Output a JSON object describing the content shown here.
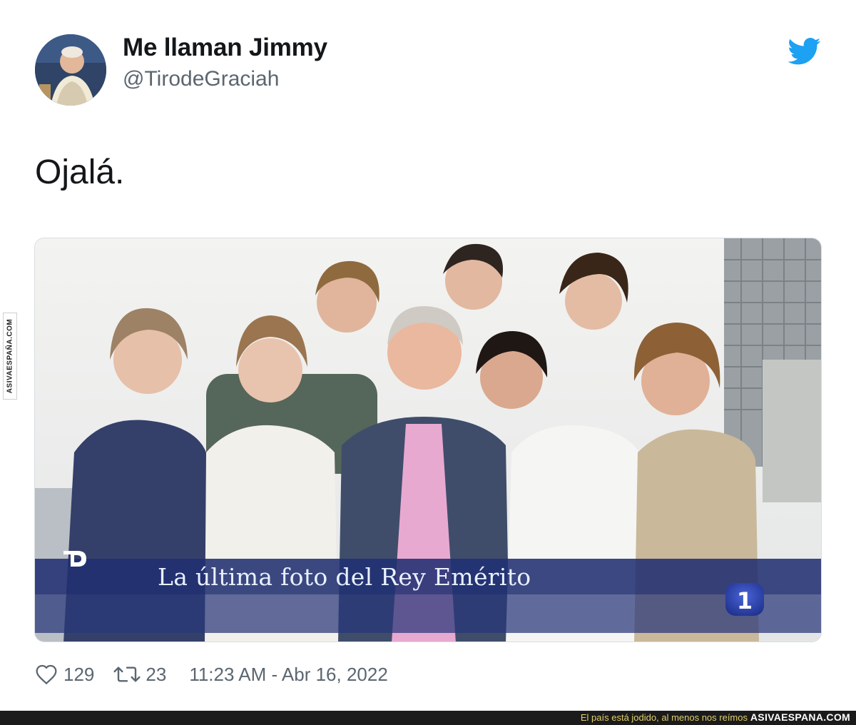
{
  "tweet": {
    "display_name": "Me llaman Jimmy",
    "handle": "@TirodeGraciah",
    "text": "Ojalá.",
    "avatar_icon": "user-avatar",
    "brand_icon": "twitter-bird-icon",
    "brand_color": "#1da1f2"
  },
  "media": {
    "caption": "La última foto del Rey Emérito",
    "channel_badge": "1",
    "news_logo_icon": "telediario-logo-icon"
  },
  "stats": {
    "likes": "129",
    "retweets": "23",
    "timestamp": "11:23 AM - Abr 16, 2022",
    "like_icon": "heart-icon",
    "retweet_icon": "retweet-icon"
  },
  "footer": {
    "slogan": "El país está jodido, al menos nos reímos",
    "site": "ASIVAESPANA.COM"
  },
  "watermark": {
    "text": "ASIVAESPAÑA.COM"
  }
}
